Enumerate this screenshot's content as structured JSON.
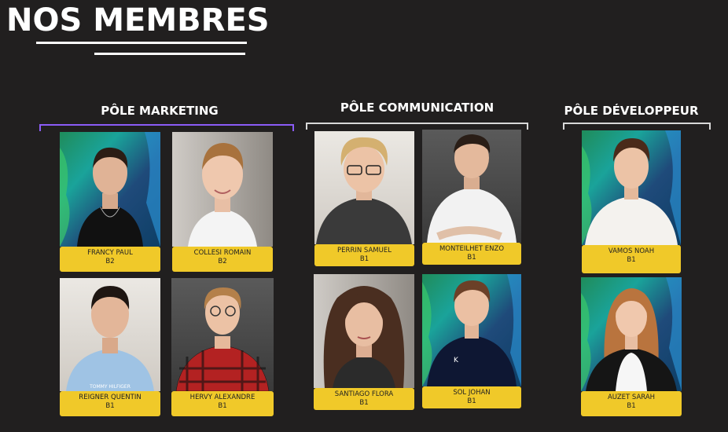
{
  "page": {
    "title": "NOS MEMBRES"
  },
  "poles": [
    {
      "title": "PÔLE MARKETING",
      "members": [
        {
          "name": "FRANCY PAUL",
          "year": "B2"
        },
        {
          "name": "COLLESI ROMAIN",
          "year": "B2"
        },
        {
          "name": "REIGNER QUENTIN",
          "year": "B1"
        },
        {
          "name": "HERVY ALEXANDRE",
          "year": "B1"
        }
      ]
    },
    {
      "title": "PÔLE COMMUNICATION",
      "members": [
        {
          "name": "PERRIN SAMUEL",
          "year": "B1"
        },
        {
          "name": "MONTEILHET ENZO",
          "year": "B1"
        },
        {
          "name": "SANTIAGO FLORA",
          "year": "B1"
        },
        {
          "name": "SOL JOHAN",
          "year": "B1"
        }
      ]
    },
    {
      "title": "PÔLE DÉVELOPPEUR",
      "members": [
        {
          "name": "VAMOS NOAH",
          "year": "B1"
        },
        {
          "name": "AUZET SARAH",
          "year": "B1"
        }
      ]
    }
  ],
  "colors": {
    "background": "#211f1f",
    "nameplate": "#f0c929",
    "marketing_accent": "#8b5cf6",
    "bracket": "#d8d8d8"
  }
}
